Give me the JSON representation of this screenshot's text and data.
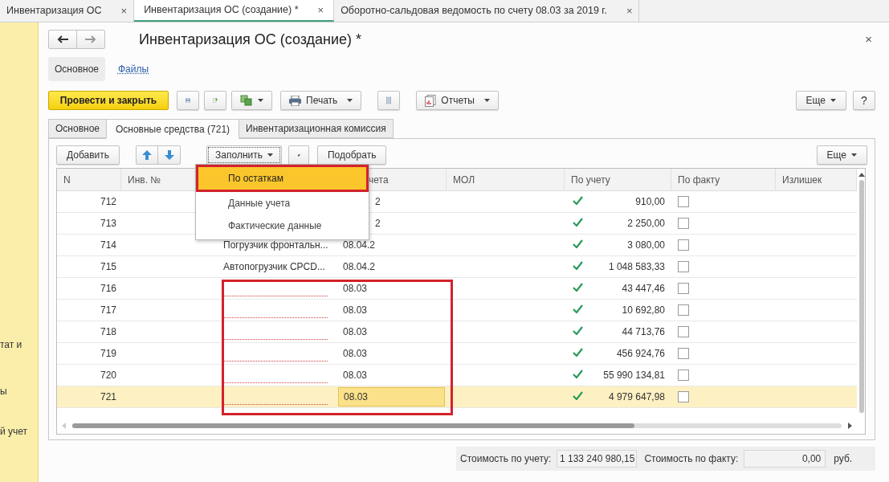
{
  "window_tabs": [
    {
      "label": "Инвентаризация ОС",
      "close": "×",
      "selected": false
    },
    {
      "label": "Инвентаризация ОС (создание) *",
      "close": "×",
      "selected": true
    },
    {
      "label": "Оборотно-сальдовая ведомость по счету 08.03 за 2019 г.",
      "close": "×",
      "selected": false
    }
  ],
  "sidebar": {
    "items": [
      "тат и",
      "ы",
      "й учет"
    ]
  },
  "form": {
    "title": "Инвентаризация ОС (создание) *",
    "close": "×"
  },
  "sections": [
    {
      "label": "Основное",
      "selected": true
    },
    {
      "label": "Файлы",
      "selected": false
    }
  ],
  "toolbar": {
    "post_button": "Провести и закрыть",
    "print_button": "Печать",
    "reports_button": "Отчеты",
    "more_button": "Еще",
    "help_button": "?"
  },
  "tabs": [
    {
      "label": "Основное",
      "selected": false
    },
    {
      "label": "Основные средства (721)",
      "selected": true
    },
    {
      "label": "Инвентаризационная комиссия",
      "selected": false
    }
  ],
  "table_toolbar": {
    "add_button": "Добавить",
    "fill_button": "Заполнить",
    "pick_button": "Подобрать",
    "more_button": "Еще"
  },
  "fill_menu": [
    {
      "label": "По остаткам",
      "selected": true
    },
    {
      "label": "Данные учета",
      "selected": false
    },
    {
      "label": "Фактические данные",
      "selected": false
    }
  ],
  "table": {
    "columns": [
      "N",
      "Инв. №",
      "чета",
      "МОЛ",
      "По учету",
      "По факту",
      "Излишек"
    ],
    "rows": [
      {
        "n": "712",
        "account_partial": "2",
        "by_account": true,
        "amount": "910,00",
        "by_fact": false,
        "selected": false
      },
      {
        "n": "713",
        "account_partial": "2",
        "by_account": true,
        "amount": "2 250,00",
        "by_fact": false,
        "selected": false
      },
      {
        "n": "714",
        "name": "Погрузчик фронтальн...",
        "account": "08.04.2",
        "by_account": true,
        "amount": "3 080,00",
        "by_fact": false,
        "selected": false
      },
      {
        "n": "715",
        "name": "Автопогрузчик CPCD...",
        "account": "08.04.2",
        "by_account": true,
        "amount": "1 048 583,33",
        "by_fact": false,
        "selected": false
      },
      {
        "n": "716",
        "name_required": true,
        "account": "08.03",
        "by_account": true,
        "amount": "43 447,46",
        "by_fact": false,
        "selected": false
      },
      {
        "n": "717",
        "name_required": true,
        "account": "08.03",
        "by_account": true,
        "amount": "10 692,80",
        "by_fact": false,
        "selected": false
      },
      {
        "n": "718",
        "name_required": true,
        "account": "08.03",
        "by_account": true,
        "amount": "44 713,76",
        "by_fact": false,
        "selected": false
      },
      {
        "n": "719",
        "name_required": true,
        "account": "08.03",
        "by_account": true,
        "amount": "456 924,76",
        "by_fact": false,
        "selected": false
      },
      {
        "n": "720",
        "name_required": true,
        "account": "08.03",
        "by_account": true,
        "amount": "55 990 134,81",
        "by_fact": false,
        "selected": false
      },
      {
        "n": "721",
        "name_required": true,
        "account": "08.03",
        "by_account": true,
        "amount": "4 979 647,98",
        "by_fact": false,
        "selected": true
      }
    ]
  },
  "totals": {
    "by_account_label": "Стоимость по учету:",
    "by_account_value": "1 133 240 980,15",
    "by_fact_label": "Стоимость по факту:",
    "by_fact_value": "0,00",
    "currency": "руб."
  }
}
